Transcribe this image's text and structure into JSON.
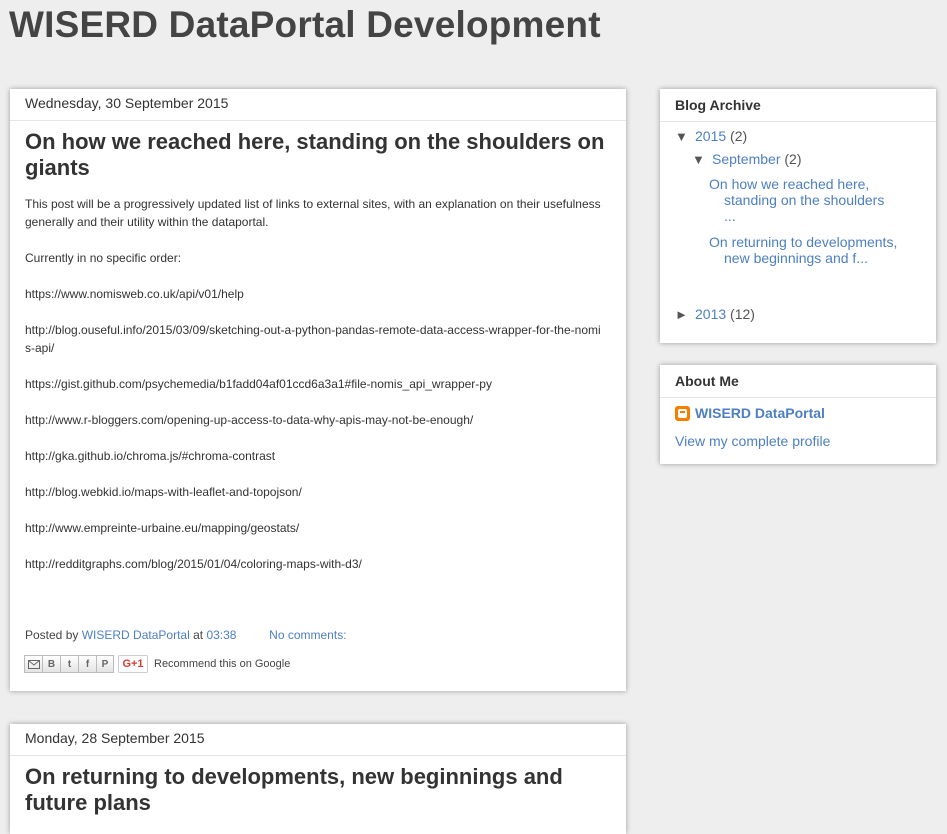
{
  "blog": {
    "title": "WISERD DataPortal Development"
  },
  "posts": [
    {
      "date": "Wednesday, 30 September 2015",
      "title": "On how we reached here, standing on the shoulders on giants",
      "intro": "This post will be a progressively updated list of links to external sites, with an explanation on their usefulness generally and their utility within the dataportal.",
      "subheading": "Currently in no specific order:",
      "links": [
        "https://www.nomisweb.co.uk/api/v01/help",
        "http://blog.ouseful.info/2015/03/09/sketching-out-a-python-pandas-remote-data-access-wrapper-for-the-nomis-api/",
        "https://gist.github.com/psychemedia/b1fadd04af01ccd6a3a1#file-nomis_api_wrapper-py",
        "http://www.r-bloggers.com/opening-up-access-to-data-why-apis-may-not-be-enough/",
        "http://gka.github.io/chroma.js/#chroma-contrast",
        "http://blog.webkid.io/maps-with-leaflet-and-topojson/",
        "http://www.empreinte-urbaine.eu/mapping/geostats/",
        "http://redditgraphs.com/blog/2015/01/04/coloring-maps-with-d3/"
      ],
      "footer": {
        "posted_by": "Posted by",
        "author": "WISERD DataPortal",
        "at": "at",
        "time": "03:38",
        "comments": "No comments:"
      },
      "share": {
        "gplus": "G+1",
        "recommend": "Recommend this on Google"
      }
    },
    {
      "date": "Monday, 28 September 2015",
      "title": "On returning to developments, new beginnings and future plans"
    }
  ],
  "sidebar": {
    "archive": {
      "title": "Blog Archive",
      "year_2015": {
        "label": "2015",
        "count": "(2)",
        "toggle": "▼"
      },
      "month_sep": {
        "label": "September",
        "count": "(2)",
        "toggle": "▼"
      },
      "posts": [
        "On how we reached here, standing on the shoulders ...",
        "On returning to developments, new beginnings and f..."
      ],
      "year_2013": {
        "label": "2013",
        "count": "(12)",
        "toggle": "►"
      }
    },
    "about": {
      "title": "About Me",
      "name": "WISERD DataPortal",
      "profile_link": "View my complete profile"
    }
  },
  "colors": {
    "link": "#4d7fc2",
    "background": "#eeeeee",
    "title": "#444444",
    "blogger_orange": "#f57d00"
  }
}
